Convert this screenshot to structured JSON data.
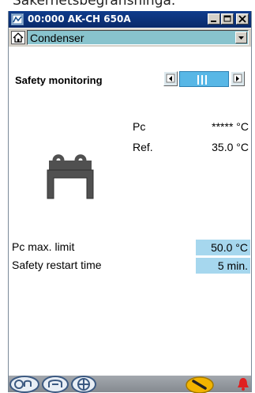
{
  "window": {
    "title": "00:000 AK-CH 650A",
    "minimize_label": "minimize",
    "maximize_label": "maximize",
    "close_label": "close"
  },
  "top_caption": "Sakerhetsbegransninga.",
  "navigation": {
    "current_view": "Condenser"
  },
  "section": {
    "title": "Safety monitoring",
    "page_indicator_bars": 3
  },
  "readouts": [
    {
      "label": "Pc",
      "value": "***** °C"
    },
    {
      "label": "Ref.",
      "value": "35.0 °C"
    }
  ],
  "settings": [
    {
      "label": "Pc max. limit",
      "value": "50.0 °C"
    },
    {
      "label": "Safety restart time",
      "value": "5 min."
    }
  ],
  "statusbar": {
    "icons": [
      "compressor-icon",
      "compressor-alt-icon",
      "fan-icon",
      "service-wrench-icon",
      "alarm-bell-icon"
    ]
  },
  "colors": {
    "title_bar": "#0f3c8c",
    "dropdown_bg": "#88c3cd",
    "page_indicator": "#58b7e6",
    "field_bg": "#a6d7ee",
    "alarm": "#e02020",
    "service_button": "#f2b400"
  }
}
